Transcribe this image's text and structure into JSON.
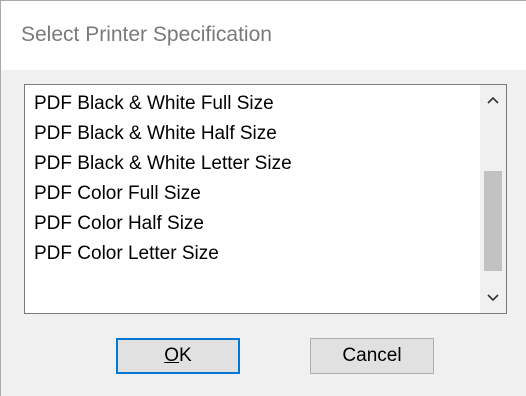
{
  "dialog": {
    "title": "Select Printer Specification"
  },
  "list": {
    "items": [
      {
        "label": "PDF Black & White Full Size"
      },
      {
        "label": "PDF Black & White Half Size"
      },
      {
        "label": "PDF Black & White Letter Size"
      },
      {
        "label": "PDF Color Full Size"
      },
      {
        "label": "PDF Color Half Size"
      },
      {
        "label": "PDF Color Letter Size"
      }
    ]
  },
  "buttons": {
    "ok_mnemonic": "O",
    "ok_rest": "K",
    "cancel_label": "Cancel"
  },
  "icons": {
    "scroll_up": "chevron-up-icon",
    "scroll_down": "chevron-down-icon"
  },
  "colors": {
    "default_button_border": "#0078d7",
    "scroll_thumb": "#c2c2c2"
  }
}
